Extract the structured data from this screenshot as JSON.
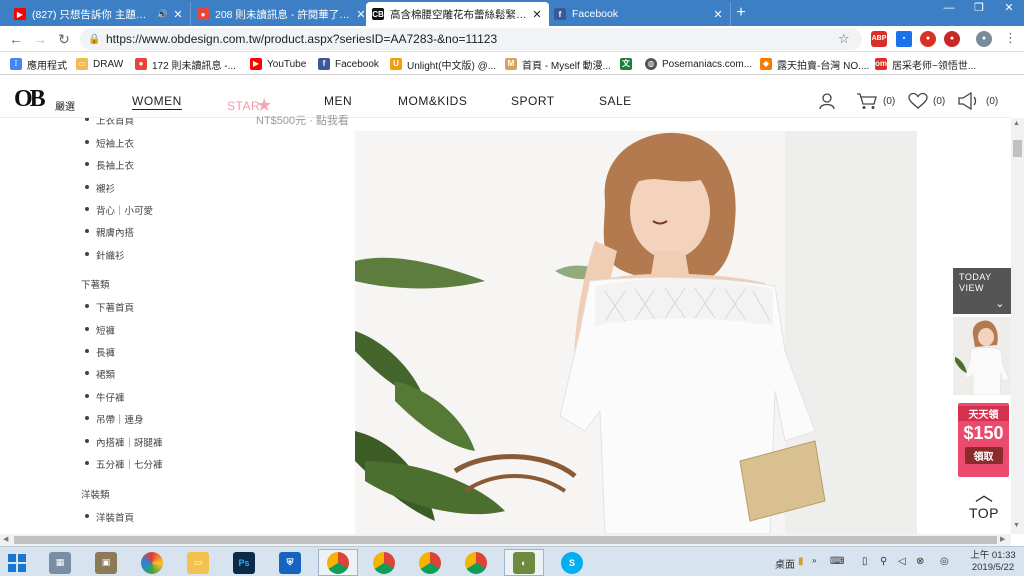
{
  "browser": {
    "tabs": [
      {
        "title": "(827) 只想告訴你 主題曲 き",
        "favicon": "youtube-icon",
        "color": "#ff0000",
        "active": false
      },
      {
        "title": "208 則未讀訊息 - 許閱華了ん(令",
        "favicon": "notification-icon",
        "color": "#e9453a",
        "active": false
      },
      {
        "title": "高含棉腰空雕花布蕾絲鬆緊一字",
        "favicon": "ob-icon",
        "color": "#111111",
        "active": true
      },
      {
        "title": "Facebook",
        "favicon": "facebook-icon",
        "color": "#3b5998",
        "active": false
      }
    ],
    "url": "https://www.obdesign.com.tw/product.aspx?seriesID=AA7283-&no=11123",
    "bookmarks": [
      {
        "label": "應用程式",
        "icon": "apps-icon",
        "color": "#4285f4"
      },
      {
        "label": "DRAW",
        "icon": "folder-icon",
        "color": "#f2b84b"
      },
      {
        "label": "172 則未讀訊息 -...",
        "icon": "notification-icon",
        "color": "#e9453a"
      },
      {
        "label": "YouTube",
        "icon": "youtube-icon",
        "color": "#ff0000"
      },
      {
        "label": "Facebook",
        "icon": "facebook-icon",
        "color": "#3b5998"
      },
      {
        "label": "Unlight(中文版) @...",
        "icon": "game-icon",
        "color": "#f39c12"
      },
      {
        "label": "首頁 - Myself 動漫...",
        "icon": "anime-icon",
        "color": "#d8a35d"
      },
      {
        "label": "",
        "icon": "translate-icon",
        "color": "#188038"
      },
      {
        "label": "Posemaniacs.com...",
        "icon": "globe-icon",
        "color": "#555555"
      },
      {
        "label": "露天拍賣-台灣 NO....",
        "icon": "ruten-icon",
        "color": "#f57c00"
      },
      {
        "label": "居采老师~领悟世...",
        "icon": "om-icon",
        "color": "#d93025"
      }
    ]
  },
  "site": {
    "logo": "OB",
    "logo_sub": "嚴選",
    "nav": [
      "WOMEN",
      "STAR",
      "MEN",
      "MOM&KIDS",
      "SPORT",
      "SALE"
    ],
    "counts": {
      "cart": "(0)",
      "wish": "(0)",
      "notice": "(0)"
    },
    "price_faded": "NT$500元 · 點我看",
    "sidebar": {
      "top_items": [
        "上衣首頁",
        "短袖上衣",
        "長袖上衣",
        "襯衫",
        "背心｜小可愛",
        "親膚內搭",
        "針織衫"
      ],
      "bottoms_title": "下著類",
      "bottoms_items": [
        "下著首頁",
        "短褲",
        "長褲",
        "裙類",
        "牛仔褲",
        "吊帶｜連身",
        "內搭褲｜訝腿褲",
        "五分褲｜七分褲"
      ],
      "dress_title": "洋裝類",
      "dress_items": [
        "洋裝首頁"
      ]
    },
    "today_view": "TODAY VIEW",
    "promo": {
      "line1": "天天領",
      "amount": "$150",
      "cta": "領取"
    },
    "top_label": "TOP"
  },
  "taskbar": {
    "tray_label": "桌面",
    "time": "上午 01:33",
    "date": "2019/5/22"
  }
}
